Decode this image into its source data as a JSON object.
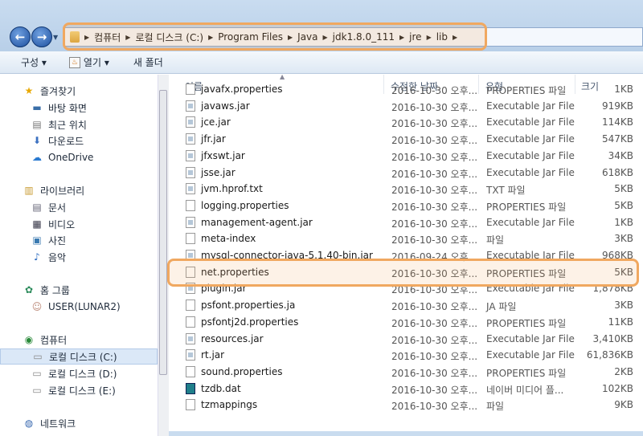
{
  "nav": {
    "back": "←",
    "forward": "→",
    "path": [
      "컴퓨터",
      "로컬 디스크 (C:)",
      "Program Files",
      "Java",
      "jdk1.8.0_111",
      "jre",
      "lib"
    ]
  },
  "toolbar": {
    "organize": "구성 ▾",
    "open": "열기 ▾",
    "new_folder": "새 폴더"
  },
  "sidebar": {
    "items": [
      {
        "label": "즐겨찾기",
        "icon": "★"
      },
      {
        "label": "바탕 화면",
        "icon": "▬"
      },
      {
        "label": "최근 위치",
        "icon": "▤"
      },
      {
        "label": "다운로드",
        "icon": "⬇"
      },
      {
        "label": "OneDrive",
        "icon": "☁"
      },
      {
        "label": "라이브러리",
        "icon": "▥"
      },
      {
        "label": "문서",
        "icon": "▤"
      },
      {
        "label": "비디오",
        "icon": "▦"
      },
      {
        "label": "사진",
        "icon": "▣"
      },
      {
        "label": "음악",
        "icon": "♪"
      },
      {
        "label": "홈 그룹",
        "icon": "✿"
      },
      {
        "label": "USER(LUNAR2)",
        "icon": "☺"
      },
      {
        "label": "컴퓨터",
        "icon": "◉"
      },
      {
        "label": "로컬 디스크 (C:)",
        "icon": "▭"
      },
      {
        "label": "로컬 디스크 (D:)",
        "icon": "▭"
      },
      {
        "label": "로컬 디스크 (E:)",
        "icon": "▭"
      },
      {
        "label": "네트워크",
        "icon": "◍"
      }
    ]
  },
  "columns": {
    "name": "이름",
    "date": "수정한 날짜",
    "type": "유형",
    "size": "크기"
  },
  "files": [
    {
      "name": "javafx.properties",
      "date": "2016-10-30 오후...",
      "type": "PROPERTIES 파일",
      "size": "1KB",
      "kind": "file"
    },
    {
      "name": "javaws.jar",
      "date": "2016-10-30 오후...",
      "type": "Executable Jar File",
      "size": "919KB",
      "kind": "jar"
    },
    {
      "name": "jce.jar",
      "date": "2016-10-30 오후...",
      "type": "Executable Jar File",
      "size": "114KB",
      "kind": "jar"
    },
    {
      "name": "jfr.jar",
      "date": "2016-10-30 오후...",
      "type": "Executable Jar File",
      "size": "547KB",
      "kind": "jar"
    },
    {
      "name": "jfxswt.jar",
      "date": "2016-10-30 오후...",
      "type": "Executable Jar File",
      "size": "34KB",
      "kind": "jar"
    },
    {
      "name": "jsse.jar",
      "date": "2016-10-30 오후...",
      "type": "Executable Jar File",
      "size": "618KB",
      "kind": "jar"
    },
    {
      "name": "jvm.hprof.txt",
      "date": "2016-10-30 오후...",
      "type": "TXT 파일",
      "size": "5KB",
      "kind": "jar"
    },
    {
      "name": "logging.properties",
      "date": "2016-10-30 오후...",
      "type": "PROPERTIES 파일",
      "size": "5KB",
      "kind": "file"
    },
    {
      "name": "management-agent.jar",
      "date": "2016-10-30 오후...",
      "type": "Executable Jar File",
      "size": "1KB",
      "kind": "jar"
    },
    {
      "name": "meta-index",
      "date": "2016-10-30 오후...",
      "type": "파일",
      "size": "3KB",
      "kind": "file"
    },
    {
      "name": "mysql-connector-java-5.1.40-bin.jar",
      "date": "2016-09-24 오후...",
      "type": "Executable Jar File",
      "size": "968KB",
      "kind": "jar"
    },
    {
      "name": "net.properties",
      "date": "2016-10-30 오후...",
      "type": "PROPERTIES 파일",
      "size": "5KB",
      "kind": "file"
    },
    {
      "name": "plugin.jar",
      "date": "2016-10-30 오후...",
      "type": "Executable Jar File",
      "size": "1,878KB",
      "kind": "jar"
    },
    {
      "name": "psfont.properties.ja",
      "date": "2016-10-30 오후...",
      "type": "JA 파일",
      "size": "3KB",
      "kind": "file"
    },
    {
      "name": "psfontj2d.properties",
      "date": "2016-10-30 오후...",
      "type": "PROPERTIES 파일",
      "size": "11KB",
      "kind": "file"
    },
    {
      "name": "resources.jar",
      "date": "2016-10-30 오후...",
      "type": "Executable Jar File",
      "size": "3,410KB",
      "kind": "jar"
    },
    {
      "name": "rt.jar",
      "date": "2016-10-30 오후...",
      "type": "Executable Jar File",
      "size": "61,836KB",
      "kind": "jar"
    },
    {
      "name": "sound.properties",
      "date": "2016-10-30 오후...",
      "type": "PROPERTIES 파일",
      "size": "2KB",
      "kind": "file"
    },
    {
      "name": "tzdb.dat",
      "date": "2016-10-30 오후...",
      "type": "네이버 미디어 플...",
      "size": "102KB",
      "kind": "dat"
    },
    {
      "name": "tzmappings",
      "date": "2016-10-30 오후...",
      "type": "파일",
      "size": "9KB",
      "kind": "file"
    }
  ],
  "colors": {
    "highlight": "#f0a860",
    "selected": "#dbe8f7"
  }
}
